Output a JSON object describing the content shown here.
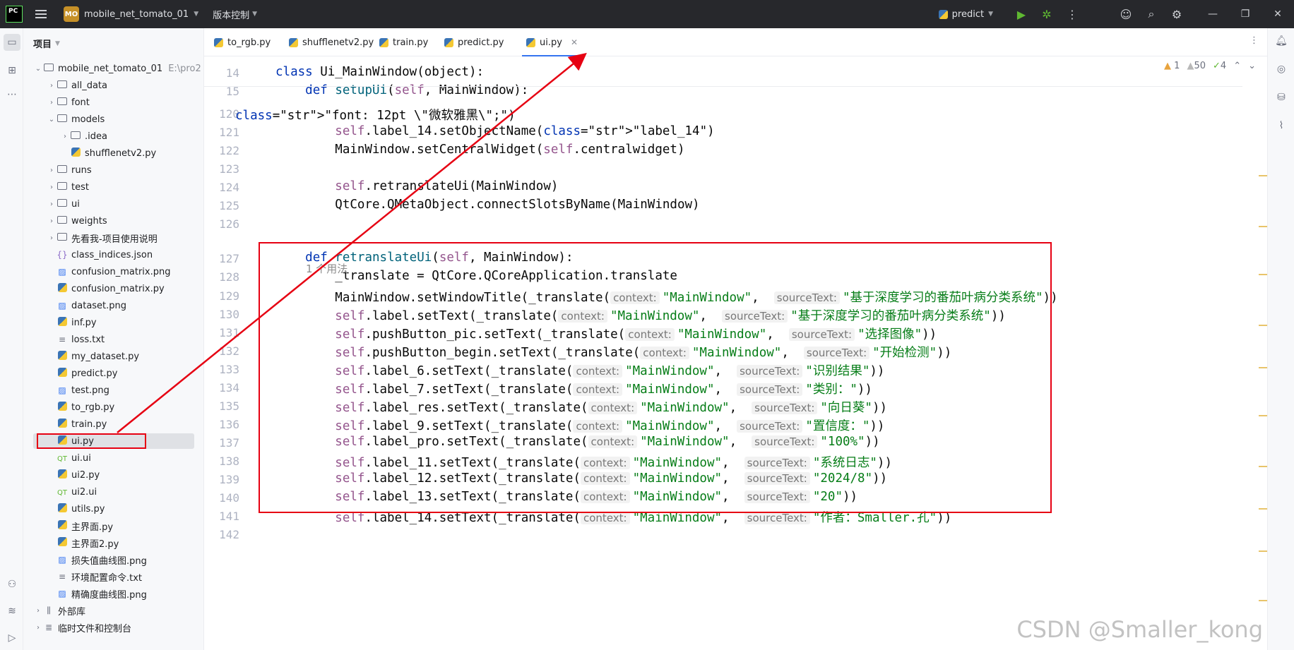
{
  "titlebar": {
    "logo": "PC",
    "project_badge": "MO",
    "project_name": "mobile_net_tomato_01",
    "vcs_label": "版本控制",
    "run_config": "predict"
  },
  "project_panel": {
    "header": "项目",
    "root_name": "mobile_net_tomato_01",
    "root_path": "E:\\pro2",
    "items": [
      {
        "label": "all_data",
        "type": "folder"
      },
      {
        "label": "font",
        "type": "folder"
      },
      {
        "label": "models",
        "type": "folder"
      },
      {
        "label": ".idea",
        "type": "folder"
      },
      {
        "label": "shufflenetv2.py",
        "type": "py"
      },
      {
        "label": "runs",
        "type": "folder"
      },
      {
        "label": "test",
        "type": "folder"
      },
      {
        "label": "ui",
        "type": "folder"
      },
      {
        "label": "weights",
        "type": "folder"
      },
      {
        "label": "先看我-项目使用说明",
        "type": "folder"
      },
      {
        "label": "class_indices.json",
        "type": "json"
      },
      {
        "label": "confusion_matrix.png",
        "type": "png"
      },
      {
        "label": "confusion_matrix.py",
        "type": "py"
      },
      {
        "label": "dataset.png",
        "type": "png"
      },
      {
        "label": "inf.py",
        "type": "py"
      },
      {
        "label": "loss.txt",
        "type": "txt"
      },
      {
        "label": "my_dataset.py",
        "type": "py"
      },
      {
        "label": "predict.py",
        "type": "py"
      },
      {
        "label": "test.png",
        "type": "png"
      },
      {
        "label": "to_rgb.py",
        "type": "py"
      },
      {
        "label": "train.py",
        "type": "py"
      },
      {
        "label": "ui.py",
        "type": "py"
      },
      {
        "label": "ui.ui",
        "type": "qt"
      },
      {
        "label": "ui2.py",
        "type": "py"
      },
      {
        "label": "ui2.ui",
        "type": "qt"
      },
      {
        "label": "utils.py",
        "type": "py"
      },
      {
        "label": "主界面.py",
        "type": "py"
      },
      {
        "label": "主界面2.py",
        "type": "py"
      },
      {
        "label": "损失值曲线图.png",
        "type": "png"
      },
      {
        "label": "环境配置命令.txt",
        "type": "txt"
      },
      {
        "label": "精确度曲线图.png",
        "type": "png"
      },
      {
        "label": "外部库",
        "type": "lib"
      },
      {
        "label": "临时文件和控制台",
        "type": "scratch"
      }
    ]
  },
  "tabs": [
    {
      "label": "to_rgb.py"
    },
    {
      "label": "shufflenetv2.py"
    },
    {
      "label": "train.py"
    },
    {
      "label": "predict.py"
    },
    {
      "label": "ui.py",
      "active": true
    }
  ],
  "inspections": {
    "warnings": "1",
    "weak_warnings": "50",
    "typos": "4"
  },
  "editor": {
    "usages_hint": "1 个用法",
    "lines": [
      {
        "n": "14",
        "text": "class Ui_MainWindow(object):"
      },
      {
        "n": "15",
        "text": "    def setupUi(self, MainWindow):"
      },
      {
        "n": "120",
        "text": "\"font: 12pt \\\"微软雅黑\\\";\")"
      },
      {
        "n": "121",
        "text": "        self.label_14.setObjectName(\"label_14\")"
      },
      {
        "n": "122",
        "text": "        MainWindow.setCentralWidget(self.centralwidget)"
      },
      {
        "n": "123",
        "text": ""
      },
      {
        "n": "124",
        "text": "        self.retranslateUi(MainWindow)"
      },
      {
        "n": "125",
        "text": "        QtCore.QMetaObject.connectSlotsByName(MainWindow)"
      },
      {
        "n": "126",
        "text": ""
      },
      {
        "n": "127",
        "text": "    def retranslateUi(self, MainWindow):"
      },
      {
        "n": "128",
        "text": "        _translate = QtCore.QCoreApplication.translate"
      },
      {
        "n": "129",
        "text": "        MainWindow.setWindowTitle(_translate(",
        "ctx": "\"MainWindow\"",
        "src": "\"基于深度学习的番茄叶病分类系统\"))"
      },
      {
        "n": "130",
        "text": "        self.label.setText(_translate(",
        "ctx": "\"MainWindow\"",
        "src": "\"基于深度学习的番茄叶病分类系统\"))"
      },
      {
        "n": "131",
        "text": "        self.pushButton_pic.setText(_translate(",
        "ctx": "\"MainWindow\"",
        "src": "\"选择图像\"))"
      },
      {
        "n": "132",
        "text": "        self.pushButton_begin.setText(_translate(",
        "ctx": "\"MainWindow\"",
        "src": "\"开始检测\"))"
      },
      {
        "n": "133",
        "text": "        self.label_6.setText(_translate(",
        "ctx": "\"MainWindow\"",
        "src": "\"识别结果\"))"
      },
      {
        "n": "134",
        "text": "        self.label_7.setText(_translate(",
        "ctx": "\"MainWindow\"",
        "src": "\"类别：\"))"
      },
      {
        "n": "135",
        "text": "        self.label_res.setText(_translate(",
        "ctx": "\"MainWindow\"",
        "src": "\"向日葵\"))"
      },
      {
        "n": "136",
        "text": "        self.label_9.setText(_translate(",
        "ctx": "\"MainWindow\"",
        "src": "\"置信度：\"))"
      },
      {
        "n": "137",
        "text": "        self.label_pro.setText(_translate(",
        "ctx": "\"MainWindow\"",
        "src": "\"100%\"))"
      },
      {
        "n": "138",
        "text": "        self.label_11.setText(_translate(",
        "ctx": "\"MainWindow\"",
        "src": "\"系统日志\"))"
      },
      {
        "n": "139",
        "text": "        self.label_12.setText(_translate(",
        "ctx": "\"MainWindow\"",
        "src": "\"2024/8\"))"
      },
      {
        "n": "140",
        "text": "        self.label_13.setText(_translate(",
        "ctx": "\"MainWindow\"",
        "src": "\"20\"))"
      },
      {
        "n": "141",
        "text": "        self.label_14.setText(_translate(",
        "ctx": "\"MainWindow\"",
        "src": "\"作者：Smaller.孔\"))"
      },
      {
        "n": "142",
        "text": ""
      }
    ],
    "hint_context": "context:",
    "hint_source": "sourceText:"
  },
  "watermark": "CSDN @Smaller_kong",
  "colors": {
    "annotation": "#e60012",
    "accent": "#3574f0"
  }
}
